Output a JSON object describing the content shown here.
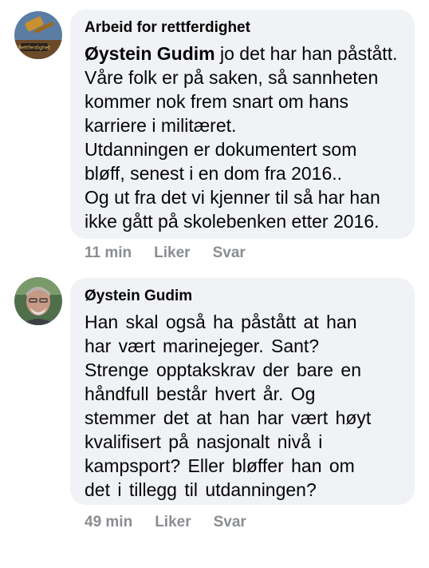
{
  "comments": [
    {
      "author": "Arbeid for rettferdighet",
      "mention": "Øystein Gudim",
      "text": " jo det har han påstått.\nVåre folk er på saken, så sannheten\nkommer nok frem snart om hans\nkarriere i militæret.\nUtdanningen er dokumentert som\nbløff, senest i en dom fra 2016..\nOg ut fra det vi kjenner til så har han\nikke gått på skolebenken etter 2016.",
      "time": "11 min",
      "like_label": "Liker",
      "reply_label": "Svar",
      "avatar_text": "Rettferdighet"
    },
    {
      "author": "Øystein Gudim",
      "text": "Han skal også ha påstått at han\nhar vært marinejeger. Sant?\nStrenge opptakskrav der bare en\nhåndfull består hvert år. Og\nstemmer det at han har vært høyt\nkvalifisert på nasjonalt nivå i\nkampsport? Eller bløffer han om\ndet i tillegg til utdanningen?",
      "time": "49 min",
      "like_label": "Liker",
      "reply_label": "Svar"
    }
  ],
  "colors": {
    "bubble": "#f0f2f5",
    "text": "#050505",
    "meta": "#8a8d91"
  }
}
